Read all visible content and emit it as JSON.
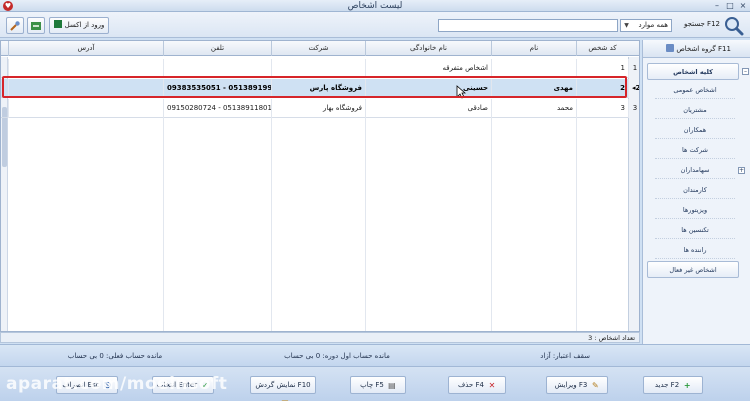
{
  "window": {
    "title": "لیست اشخاص",
    "minimize": "–",
    "maximize": "□",
    "close": "×"
  },
  "toolbar": {
    "excel_label": "ورود از اکسل",
    "search_value": "",
    "filter_value": "همه موارد",
    "search_label": "جستجو F12"
  },
  "grid": {
    "columns": [
      "کد شخص",
      "نام",
      "نام خانوادگی",
      "شرکت",
      "تلفن",
      "آدرس"
    ],
    "rows": [
      {
        "indicator": "1",
        "code": "1",
        "first": "",
        "last": "اشخاص متفرقه",
        "company": "",
        "phone": "",
        "address": ""
      },
      {
        "indicator": "2",
        "code": "2",
        "first": "مهدی",
        "last": "حسینی",
        "company": "فروشگاه پارس",
        "phone": "09383535051 - 05138919999",
        "address": ""
      },
      {
        "indicator": "3",
        "code": "3",
        "first": "محمد",
        "last": "صادقی",
        "company": "فروشگاه بهار",
        "phone": "09150280724 - 05138911801",
        "address": ""
      }
    ],
    "count_text": "تعداد اشخاص : 3"
  },
  "sidebar": {
    "title": "گروه اشخاص F11",
    "root": "کلیه اشخاص",
    "children": [
      "اشخاص عمومی",
      "مشتریان",
      "همکاران",
      "شرکت ها",
      "سهامداران",
      "کارمندان",
      "ویزیتورها",
      "تکنسین ها",
      "راننده ها"
    ],
    "inactive": "اشخاص غیر فعال"
  },
  "summary": {
    "credit": "سقف اعتبار: آزاد",
    "period": "مانده حساب اول دوره: 0 بی حساب",
    "balance": "مانده حساب فعلی: 0 بی حساب"
  },
  "actions": {
    "new": "جدید F2",
    "edit": "ویرایش F3",
    "delete": "حذف F4",
    "print": "چاپ F5",
    "turnover": "نمایش گردش F10",
    "select": "انتخاب Enter",
    "cancel": "انصراف Esc"
  },
  "watermark": "aparat.com/moeinsoft",
  "colors": {
    "selection_outline": "#d6252a",
    "selected_row": "#cfe1f3",
    "accent": "#2b5ea8"
  }
}
